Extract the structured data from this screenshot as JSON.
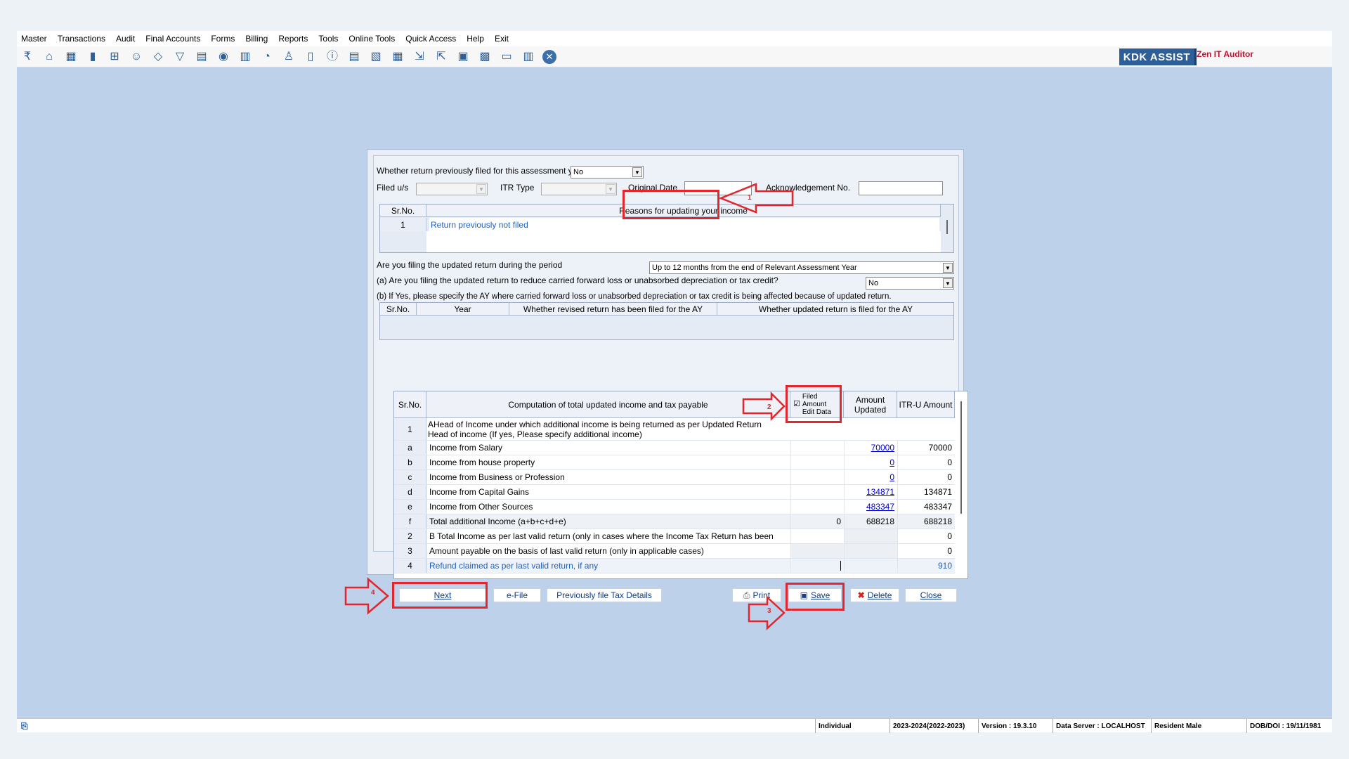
{
  "menu": [
    "Master",
    "Transactions",
    "Audit",
    "Final Accounts",
    "Forms",
    "Billing",
    "Reports",
    "Tools",
    "Online Tools",
    "Quick Access",
    "Help",
    "Exit"
  ],
  "toolbar_icons": [
    "voucher-icon",
    "home-icon",
    "ledger-icon",
    "chart-icon",
    "gift-icon",
    "group-icon",
    "tag-icon",
    "filter-icon",
    "tax-icon",
    "eye-icon",
    "calculator-icon",
    "pie-icon",
    "pay-icon",
    "book-icon",
    "info-icon",
    "report-icon",
    "document-icon",
    "calendar-icon",
    "export-icon",
    "import-icon",
    "bs-icon",
    "folder-icon",
    "3cd-icon",
    "form-icon",
    "close-circle-icon"
  ],
  "brand": {
    "kdk": "KDK ASSIST",
    "zen": "Zen IT Auditor"
  },
  "form": {
    "q_prev_filed": "Whether return previously filed for this assessment year?",
    "prev_filed_value": "No",
    "filed_us_label": "Filed u/s",
    "itr_type_label": "ITR Type",
    "original_date_label": "Original Date",
    "ack_label": "Acknowledgement No.",
    "reasons_grid": {
      "col_srno": "Sr.No.",
      "col_reason": "Reasons for updating your income",
      "rows": [
        {
          "srno": "1",
          "reason": "Return previously not filed"
        }
      ]
    },
    "q_period": "Are you filing the updated return during the period",
    "period_value": "Up to 12 months from the end of Relevant Assessment Year",
    "q_reduce": "(a) Are you filing the updated return to reduce carried forward loss or unabsorbed depreciation or tax credit?",
    "reduce_value": "No",
    "q_specify": "(b) If Yes, please specify the AY where carried forward loss or unabsorbed depreciation or tax credit is being affected because of updated return.",
    "ay_grid": {
      "col_srno": "Sr.No.",
      "col_year": "Year",
      "col_revised": "Whether revised return has been filed for the AY",
      "col_updated": "Whether updated return is filed for the AY"
    },
    "comp": {
      "col_srno": "Sr.No.",
      "col_desc": "Computation of total updated income and tax payable",
      "col_filed": "Filed Amount Edit Data",
      "col_filed_l1": "Filed",
      "col_filed_l2": "Amount",
      "col_filed_l3": "Edit Data",
      "col_amt_l1": "Amount",
      "col_amt_l2": "Updated",
      "col_itru": "ITR-U Amount",
      "rows": [
        {
          "sn": "1",
          "desc": "AHead of Income under which additional income is being returned as per Updated Return",
          "desc2": "Head of income (If yes, Please specify additional income)",
          "filed": "",
          "updated": "",
          "itru": ""
        },
        {
          "sn": "a",
          "desc": "Income from Salary",
          "filed": "",
          "updated": "70000",
          "itru": "70000"
        },
        {
          "sn": "b",
          "desc": "Income from house property",
          "filed": "",
          "updated": "0",
          "itru": "0"
        },
        {
          "sn": "c",
          "desc": "Income from Business or Profession",
          "filed": "",
          "updated": "0",
          "itru": "0"
        },
        {
          "sn": "d",
          "desc": "Income from Capital Gains",
          "filed": "",
          "updated": "134871",
          "itru": "134871"
        },
        {
          "sn": "e",
          "desc": "Income from Other Sources",
          "filed": "",
          "updated": "483347",
          "itru": "483347"
        },
        {
          "sn": "f",
          "desc": "Total additional Income (a+b+c+d+e)",
          "filed": "0",
          "updated": "688218",
          "itru": "688218"
        },
        {
          "sn": "2",
          "desc": "B Total Income as per last valid return (only in cases where the  Income Tax Return has been",
          "filed": "",
          "updated": "",
          "itru": "0"
        },
        {
          "sn": "3",
          "desc": "Amount payable  on the basis of  last valid return (only in applicable cases)",
          "filed": "",
          "updated": "",
          "itru": "0"
        },
        {
          "sn": "4",
          "desc": "Refund claimed as per last valid return, if any",
          "filed": "",
          "updated": "",
          "itru": "910"
        }
      ]
    },
    "buttons": {
      "next": "Next",
      "efile": "e-File",
      "prev_tax": "Previously file Tax Details",
      "print": "Print",
      "save": "Save",
      "delete": "Delete",
      "close": "Close"
    }
  },
  "annotations": [
    "1",
    "2",
    "3",
    "4"
  ],
  "status": {
    "type": "Individual",
    "ay": "2023-2024(2022-2023)",
    "version": "Version : 19.3.10",
    "server": "Data Server : LOCALHOST",
    "resident": "Resident Male",
    "dob": "DOB/DOI : 19/11/1981"
  },
  "colors": {
    "accent": "#2e5f99",
    "annotation": "#e3262d",
    "background": "#bdd1ea"
  }
}
